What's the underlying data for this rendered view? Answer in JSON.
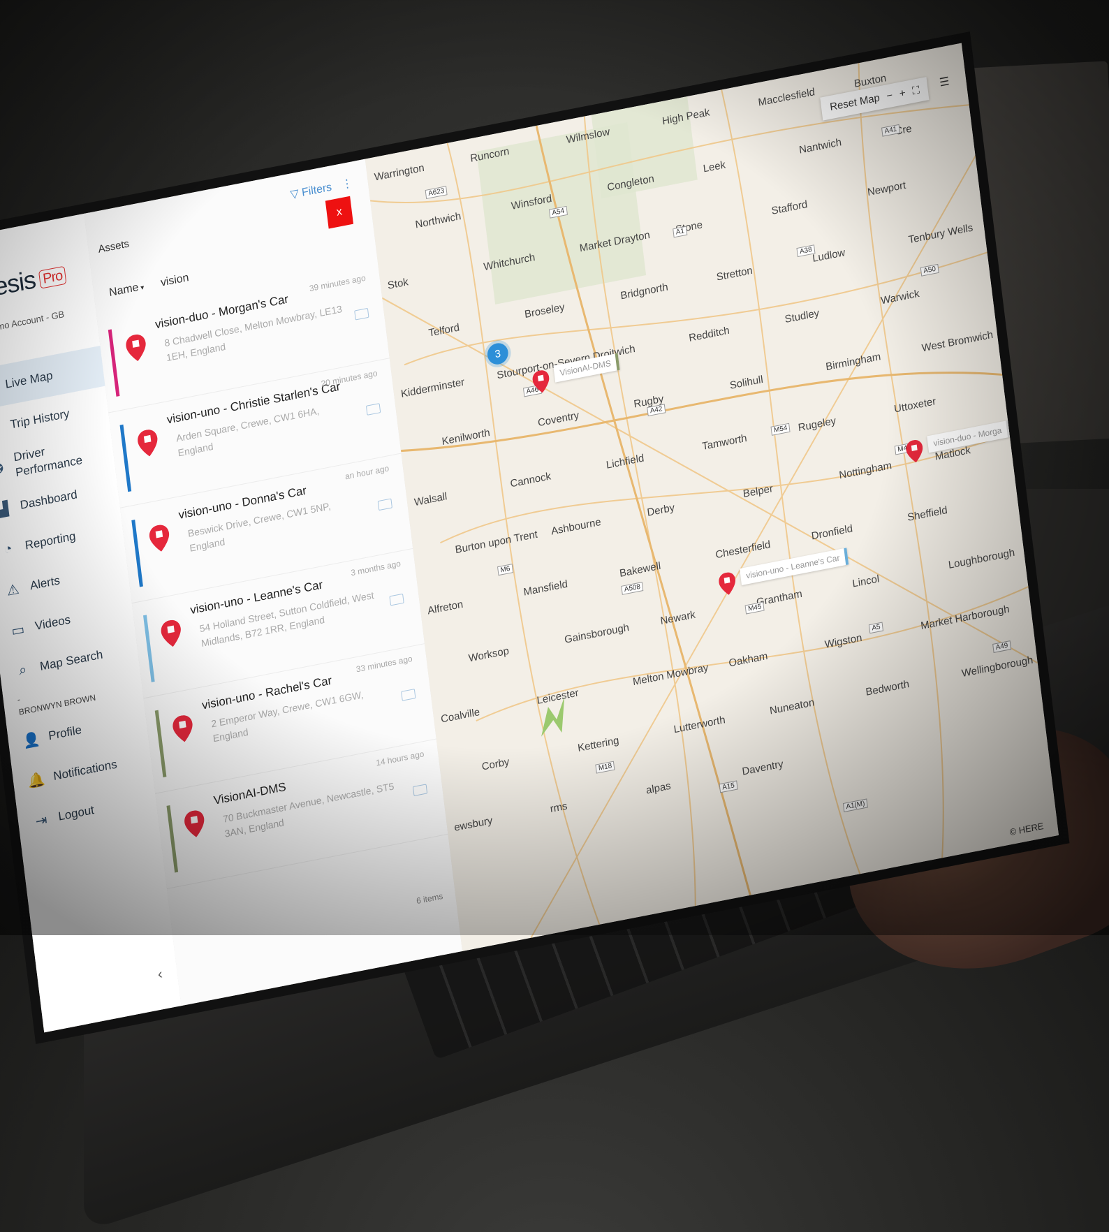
{
  "app": {
    "logo_text": "kinesis",
    "logo_badge": "Pro",
    "account": "dius Demo Account - GB"
  },
  "sidebar": {
    "items": [
      {
        "label": "Live Map",
        "icon": "globe-icon"
      },
      {
        "label": "Trip History",
        "icon": "history-icon"
      },
      {
        "label": "Driver Performance",
        "icon": "medal-icon"
      },
      {
        "label": "Dashboard",
        "icon": "dashboard-icon"
      },
      {
        "label": "Reporting",
        "icon": "pie-chart-icon"
      },
      {
        "label": "Alerts",
        "icon": "warning-icon"
      },
      {
        "label": "Videos",
        "icon": "video-icon"
      },
      {
        "label": "Map Search",
        "icon": "map-search-icon"
      }
    ],
    "user_separator": "-",
    "user_name": "BRONWYN BROWN",
    "profile_label": "Profile",
    "notifications_label": "Notifications",
    "logout_label": "Logout",
    "collapse_symbol": "‹"
  },
  "assets": {
    "title": "Assets",
    "filters_label": "Filters",
    "close_label": "x",
    "sort_label": "Name",
    "search_value": "vision",
    "count_label": "6 items",
    "items": [
      {
        "title": "vision-duo - Morgan's Car",
        "ago": "39 minutes ago",
        "address": "8 Chadwell Close, Melton Mowbray, LE13 1EH, England",
        "color": "#d6247a"
      },
      {
        "title": "vision-uno - Christie Starlen's Car",
        "ago": "20 minutes ago",
        "address": "Arden Square, Crewe, CW1 6HA, England",
        "color": "#1f78c8"
      },
      {
        "title": "vision-uno - Donna's Car",
        "ago": "an hour ago",
        "address": "Beswick Drive, Crewe, CW1 5NP, England",
        "color": "#1f78c8"
      },
      {
        "title": "vision-uno - Leanne's Car",
        "ago": "3 months ago",
        "address": "54 Holland Street, Sutton Coldfield, West Midlands, B72 1RR, England",
        "color": "#7fc0e6"
      },
      {
        "title": "vision-uno - Rachel's Car",
        "ago": "33 minutes ago",
        "address": "2 Emperor Way, Crewe, CW1 6GW, England",
        "color": "#8a9b6a"
      },
      {
        "title": "VisionAI-DMS",
        "ago": "14 hours ago",
        "address": "70 Buckmaster Avenue, Newcastle, ST5 3AN, England",
        "color": "#8a9b6a"
      }
    ]
  },
  "map": {
    "reset_label": "Reset Map",
    "zoom_out": "−",
    "zoom_in": "+",
    "fullscreen": "⛶",
    "menu": "☰",
    "attribution": "© HERE",
    "cluster_count": "3",
    "labels": {
      "visionai": "VisionAI-DMS",
      "leanne": "vision-uno - Leanne's Car",
      "morgan": "vision-duo - Morga"
    },
    "places": [
      "Warrington",
      "Runcorn",
      "Wilmslow",
      "High Peak",
      "Macclesfield",
      "Buxton",
      "Northwich",
      "Winsford",
      "Congleton",
      "Leek",
      "Nantwich",
      "Cre",
      "Stok",
      "Whitchurch",
      "Market Drayton",
      "Stone",
      "Stafford",
      "Newport",
      "Telford",
      "Broseley",
      "Bridgnorth",
      "Stretton",
      "Ludlow",
      "Tenbury Wells",
      "Kidderminster",
      "Stourport-on-Severn",
      "Droitwich",
      "Redditch",
      "Studley",
      "Warwick",
      "Kenilworth",
      "Coventry",
      "Rugby",
      "Solihull",
      "Birmingham",
      "West Bromwich",
      "Walsall",
      "Cannock",
      "Lichfield",
      "Tamworth",
      "Rugeley",
      "Uttoxeter",
      "Burton upon Trent",
      "Ashbourne",
      "Derby",
      "Belper",
      "Nottingham",
      "Matlock",
      "Alfreton",
      "Mansfield",
      "Bakewell",
      "Chesterfield",
      "Dronfield",
      "Sheffield",
      "Worksop",
      "Gainsborough",
      "Newark",
      "Grantham",
      "Lincol",
      "Loughborough",
      "Coalville",
      "Leicester",
      "Melton Mowbray",
      "Oakham",
      "Wigston",
      "Market Harborough",
      "Corby",
      "Kettering",
      "Lutterworth",
      "Nuneaton",
      "Bedworth",
      "Wellingborough",
      "ewsbury",
      "rms",
      "alpas",
      "Daventry"
    ],
    "roads": [
      "A623",
      "A54",
      "A1",
      "A38",
      "A50",
      "A46",
      "A42",
      "M54",
      "M42",
      "M6",
      "A508",
      "M45",
      "A5",
      "A49",
      "M18",
      "A15",
      "A1(M)",
      "A41"
    ]
  }
}
